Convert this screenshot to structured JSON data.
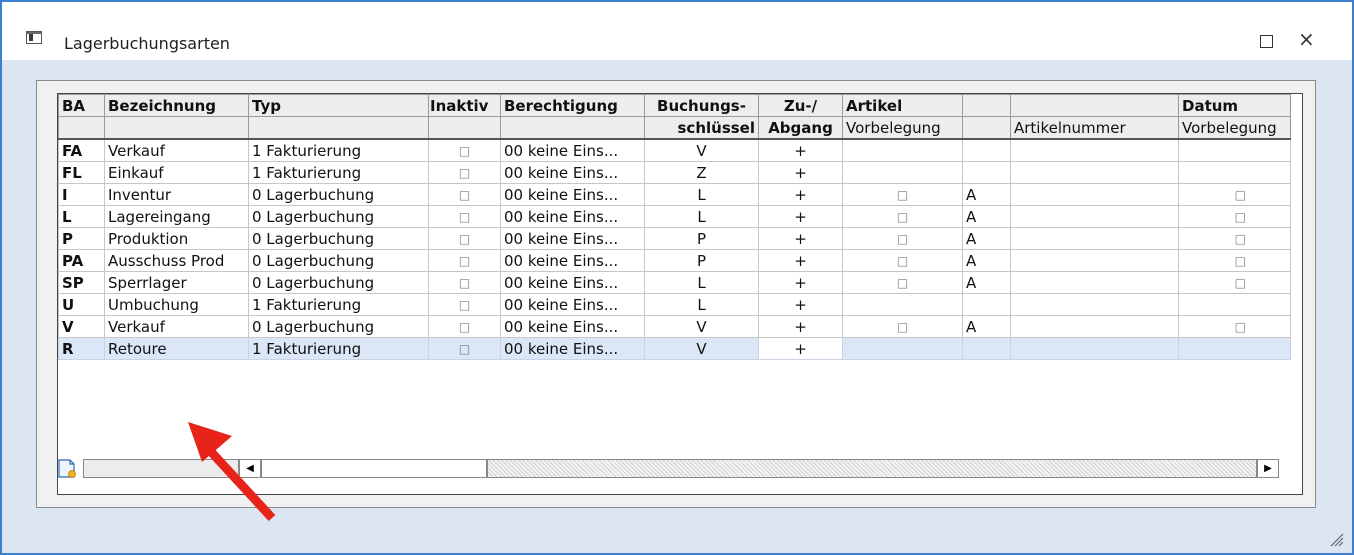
{
  "window": {
    "title": "Lagerbuchungsarten"
  },
  "columns": {
    "h1": [
      "BA",
      "Bezeichnung",
      "Typ",
      "Inaktiv",
      "Berechtigung",
      "Buchungs-",
      "Zu-/",
      "Artikel",
      "",
      "",
      "Datum"
    ],
    "h2": [
      "",
      "",
      "",
      "",
      "",
      "schlüssel",
      "Abgang",
      "Vorbelegung",
      "",
      "Artikelnummer",
      "Vorbelegung"
    ]
  },
  "checkbox_glyph": "□",
  "rows": [
    {
      "ba": "FA",
      "bez": "Verkauf",
      "typ": "1 Fakturierung",
      "inaktiv": "□",
      "ber": "00  keine Eins...",
      "bs": "V",
      "zu": "+",
      "art": "",
      "a": "",
      "artnr": "",
      "datum": ""
    },
    {
      "ba": "FL",
      "bez": "Einkauf",
      "typ": "1 Fakturierung",
      "inaktiv": "□",
      "ber": "00  keine Eins...",
      "bs": "Z",
      "zu": "+",
      "art": "",
      "a": "",
      "artnr": "",
      "datum": ""
    },
    {
      "ba": "I",
      "bez": "Inventur",
      "typ": "0 Lagerbuchung",
      "inaktiv": "□",
      "ber": "00  keine Eins...",
      "bs": "L",
      "zu": "+",
      "art": "□",
      "a": "A",
      "artnr": "",
      "datum": "□"
    },
    {
      "ba": "L",
      "bez": "Lagereingang",
      "typ": "0 Lagerbuchung",
      "inaktiv": "□",
      "ber": "00  keine Eins...",
      "bs": "L",
      "zu": "+",
      "art": "□",
      "a": "A",
      "artnr": "",
      "datum": "□"
    },
    {
      "ba": "P",
      "bez": "Produktion",
      "typ": "0 Lagerbuchung",
      "inaktiv": "□",
      "ber": "00  keine Eins...",
      "bs": "P",
      "zu": "+",
      "art": "□",
      "a": "A",
      "artnr": "",
      "datum": "□"
    },
    {
      "ba": "PA",
      "bez": "Ausschuss Prod",
      "typ": "0 Lagerbuchung",
      "inaktiv": "□",
      "ber": "00  keine Eins...",
      "bs": "P",
      "zu": "+",
      "art": "□",
      "a": "A",
      "artnr": "",
      "datum": "□"
    },
    {
      "ba": "SP",
      "bez": "Sperrlager",
      "typ": "0 Lagerbuchung",
      "inaktiv": "□",
      "ber": "00  keine Eins...",
      "bs": "L",
      "zu": "+",
      "art": "□",
      "a": "A",
      "artnr": "",
      "datum": "□"
    },
    {
      "ba": "U",
      "bez": "Umbuchung",
      "typ": "1 Fakturierung",
      "inaktiv": "□",
      "ber": "00  keine Eins...",
      "bs": "L",
      "zu": "+",
      "art": "",
      "a": "",
      "artnr": "",
      "datum": ""
    },
    {
      "ba": "V",
      "bez": "Verkauf",
      "typ": "0 Lagerbuchung",
      "inaktiv": "□",
      "ber": "00  keine Eins...",
      "bs": "V",
      "zu": "+",
      "art": "□",
      "a": "A",
      "artnr": "",
      "datum": "□"
    },
    {
      "ba": "R",
      "bez": "Retoure",
      "typ": "1 Fakturierung",
      "inaktiv": "□",
      "ber": "00  keine Eins...",
      "bs": "V",
      "zu": "+",
      "art": "",
      "a": "",
      "artnr": "",
      "datum": "",
      "selected": true
    }
  ],
  "scrollbar": {
    "left_arrow": "◀",
    "right_arrow": "▶"
  },
  "colors": {
    "window_border": "#3c7fd1",
    "selection": "#dbe6f7",
    "arrow": "#e8231a"
  },
  "icons": {
    "window": "window-icon",
    "new_record": "new-record-icon",
    "resize": "resize-grip-icon"
  }
}
